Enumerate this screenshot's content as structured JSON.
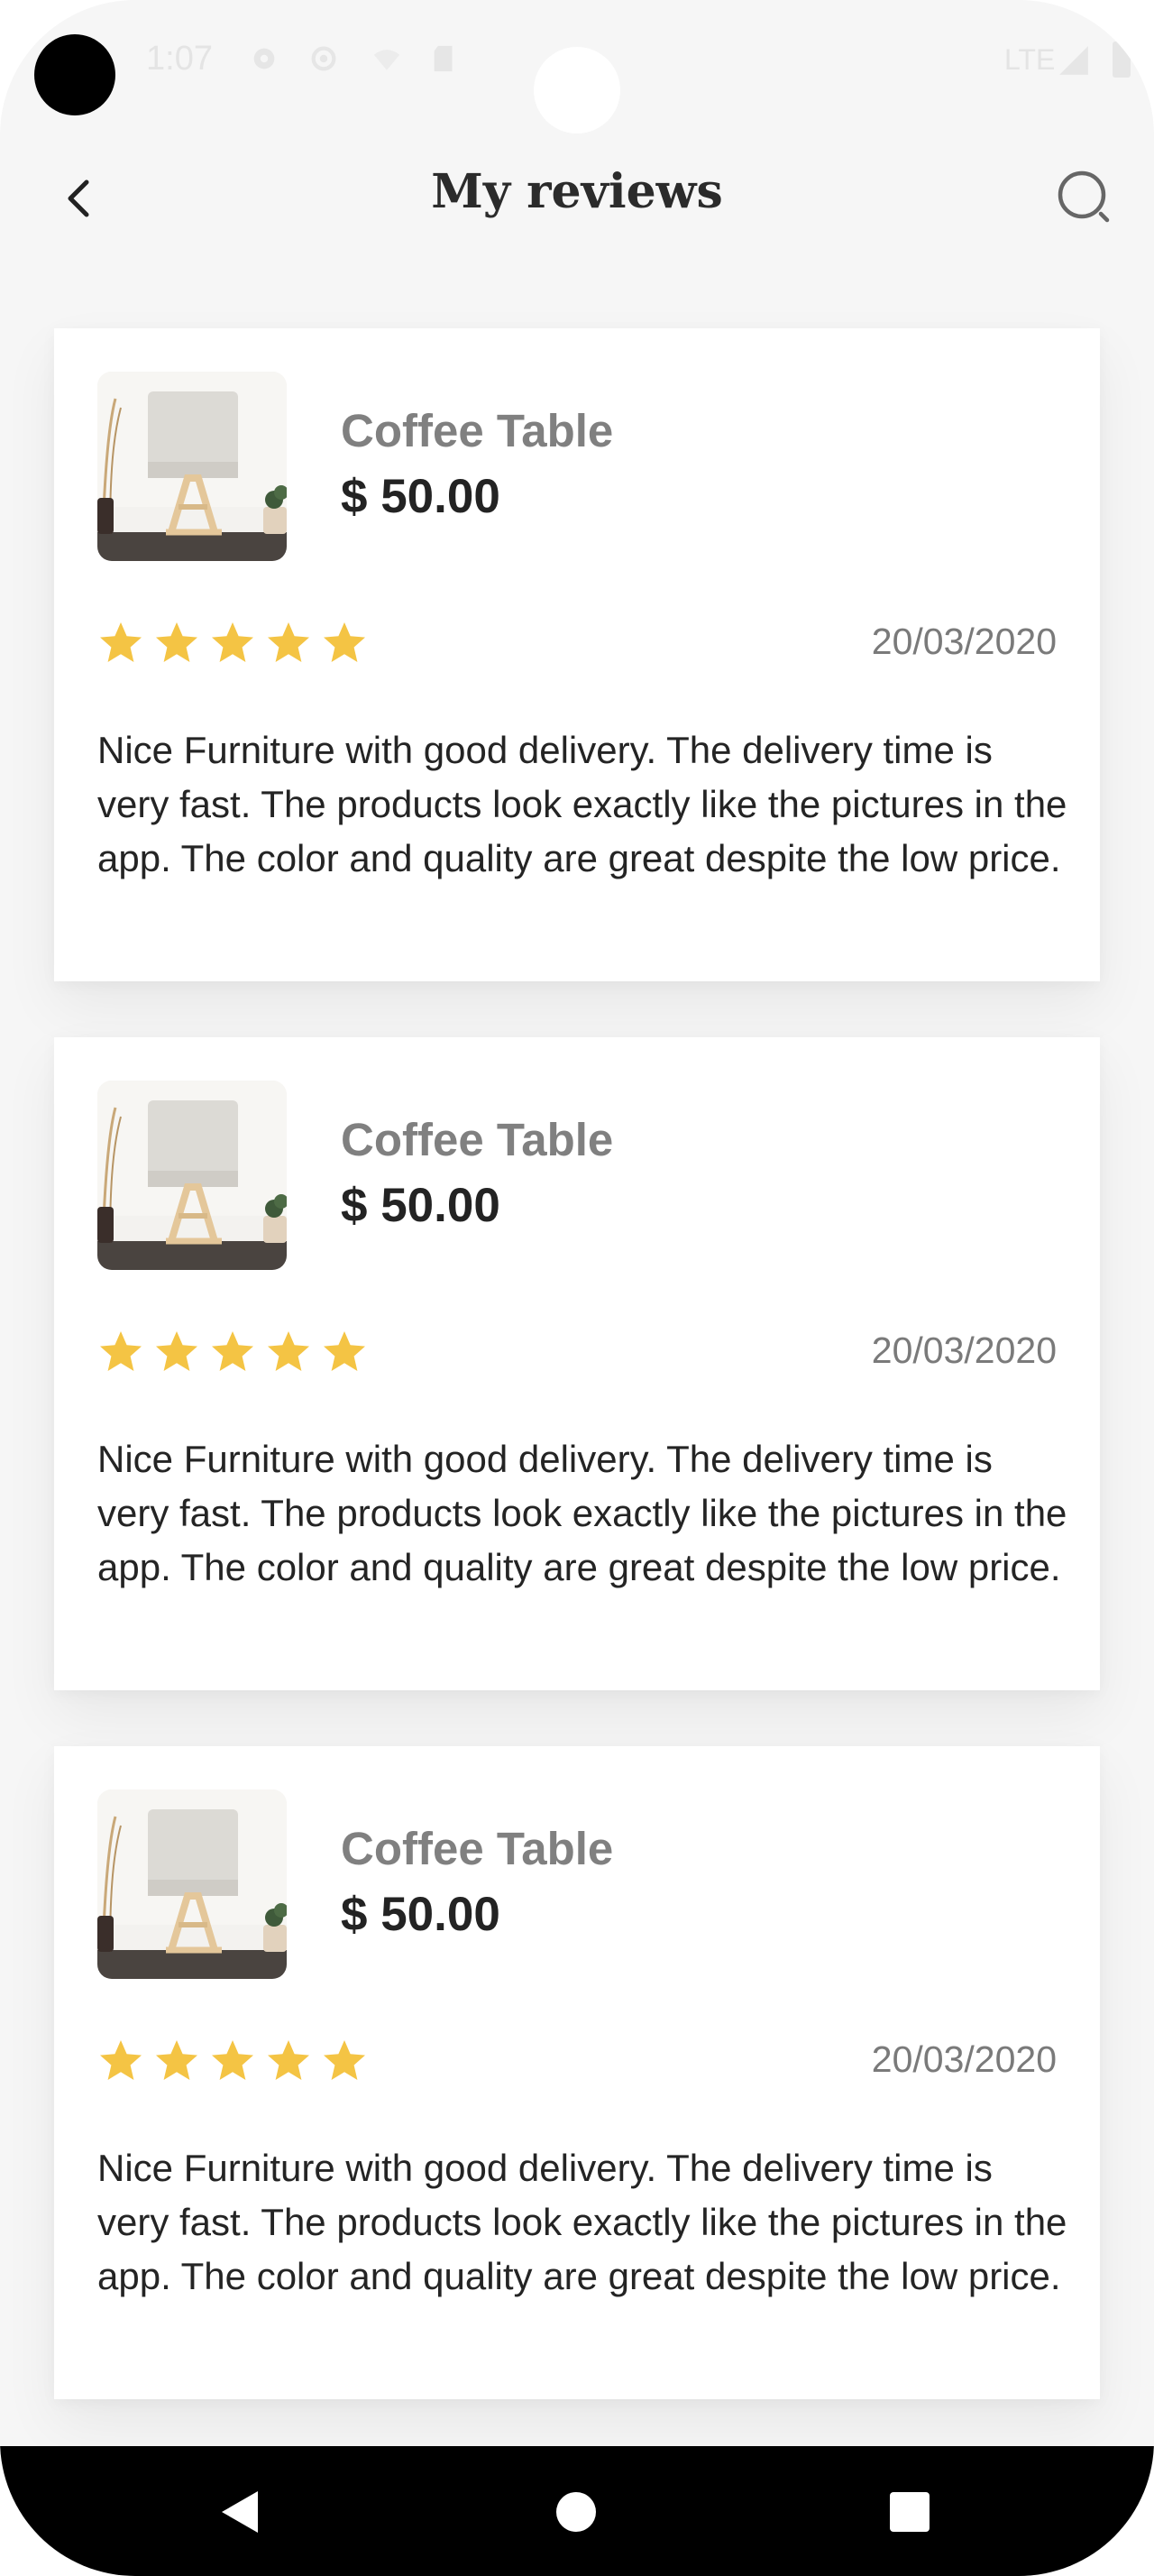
{
  "status_bar": {
    "time": "1:07",
    "network": "LTE"
  },
  "app_bar": {
    "title": "My reviews"
  },
  "colors": {
    "star": "#F4C444",
    "card_bg": "#FFFFFF",
    "screen_bg": "#F6F6F6",
    "nav_bg": "#000000"
  },
  "reviews": [
    {
      "product_name": "Coffee Table",
      "price": "$ 50.00",
      "rating": 5,
      "date": "20/03/2020",
      "text": "Nice Furniture with good delivery. The delivery time is very fast. The products look exactly like the pictures in the app. The color and quality are great despite the low price."
    },
    {
      "product_name": "Coffee Table",
      "price": "$ 50.00",
      "rating": 5,
      "date": "20/03/2020",
      "text": "Nice Furniture with good delivery. The delivery time is very fast. The products look exactly like the pictures in the app. The color and quality are great despite the low price."
    },
    {
      "product_name": "Coffee Table",
      "price": "$ 50.00",
      "rating": 5,
      "date": "20/03/2020",
      "text": "Nice Furniture with good delivery. The delivery time is very fast. The products look exactly like the pictures in the app. The color and quality are great despite the low price."
    }
  ],
  "icons": {
    "back": "chevron-left-icon",
    "search": "search-icon",
    "star": "star-icon",
    "nav_back": "triangle-back-icon",
    "nav_home": "circle-home-icon",
    "nav_recents": "square-recents-icon"
  }
}
